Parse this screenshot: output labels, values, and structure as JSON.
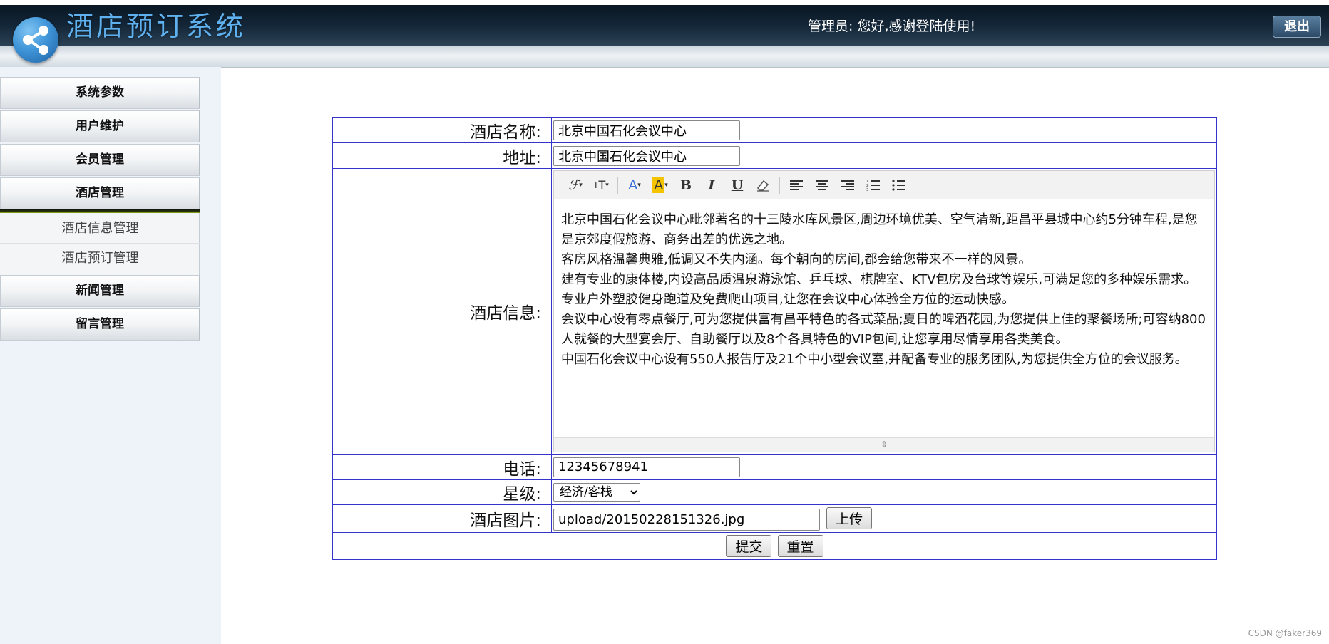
{
  "header": {
    "app_title": "酒店预订系统",
    "greeting": "管理员:  您好,感谢登陆使用!",
    "logout_label": "退出"
  },
  "sidebar": {
    "menus": [
      {
        "label": "系统参数"
      },
      {
        "label": "用户维护"
      },
      {
        "label": "会员管理"
      },
      {
        "label": "酒店管理"
      },
      {
        "label": "新闻管理"
      },
      {
        "label": "留言管理"
      }
    ],
    "submenu": [
      {
        "label": "酒店信息管理"
      },
      {
        "label": "酒店预订管理"
      }
    ]
  },
  "form": {
    "name_label": "酒店名称:",
    "name_value": "北京中国石化会议中心",
    "address_label": "地址:",
    "address_value": "北京中国石化会议中心",
    "info_label": "酒店信息:",
    "info_paragraphs": [
      "北京中国石化会议中心毗邻著名的十三陵水库风景区,周边环境优美、空气清新,距昌平县城中心约5分钟车程,是您是京郊度假旅游、商务出差的优选之地。",
      "客房风格温馨典雅,低调又不失内涵。每个朝向的房间,都会给您带来不一样的风景。",
      "建有专业的康体楼,内设高品质温泉游泳馆、乒乓球、棋牌室、KTV包房及台球等娱乐,可满足您的多种娱乐需求。专业户外塑胶健身跑道及免费爬山项目,让您在会议中心体验全方位的运动快感。",
      "会议中心设有零点餐厅,可为您提供富有昌平特色的各式菜品;夏日的啤酒花园,为您提供上佳的聚餐场所;可容纳800人就餐的大型宴会厅、自助餐厅以及8个各具特色的VIP包间,让您享用尽情享用各类美食。",
      "中国石化会议中心设有550人报告厅及21个中小型会议室,并配备专业的服务团队,为您提供全方位的会议服务。"
    ],
    "phone_label": "电话:",
    "phone_value": "12345678941",
    "star_label": "星级:",
    "star_value": "经济/客栈",
    "image_label": "酒店图片:",
    "image_value": "upload/20150228151326.jpg",
    "upload_label": "上传",
    "submit_label": "提交",
    "reset_label": "重置"
  },
  "watermark": "CSDN @faker369"
}
